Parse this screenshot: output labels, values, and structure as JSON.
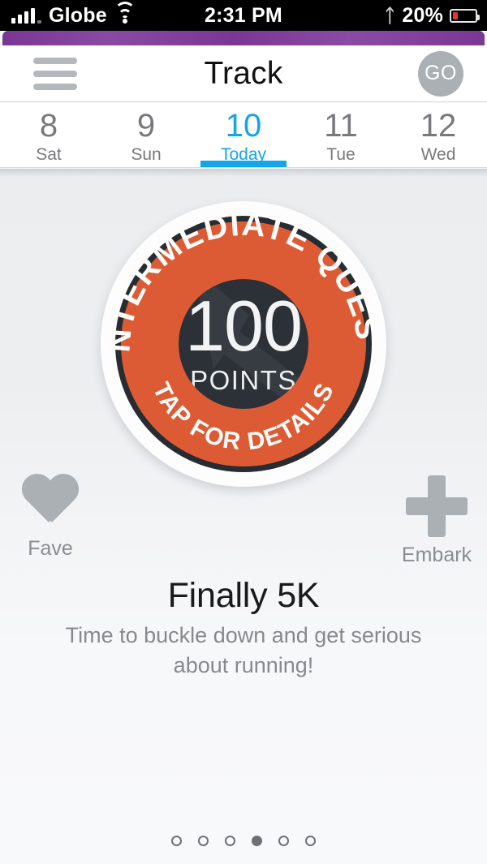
{
  "status_bar": {
    "carrier": "Globe",
    "signal_icon": "signal-bars-icon",
    "wifi_icon": "wifi-icon",
    "time": "2:31 PM",
    "bluetooth_icon": "bluetooth-icon",
    "battery_percent": "20%",
    "battery_icon": "battery-low-icon",
    "battery_level": 20,
    "battery_color": "#e8352c"
  },
  "accent_bar": {
    "color": "#7a3794"
  },
  "header": {
    "menu_icon": "hamburger-menu-icon",
    "title": "Track",
    "go_label": "GO"
  },
  "date_strip": {
    "days": [
      {
        "num": "8",
        "label": "Sat",
        "active": false
      },
      {
        "num": "9",
        "label": "Sun",
        "active": false
      },
      {
        "num": "10",
        "label": "Today",
        "active": true
      },
      {
        "num": "11",
        "label": "Tue",
        "active": false
      },
      {
        "num": "12",
        "label": "Wed",
        "active": false
      }
    ],
    "active_color": "#12a5e8",
    "inactive_color": "#78797c"
  },
  "badge": {
    "arc_top_text": "INTERMEDIATE QUEST",
    "arc_bottom_text": "TAP FOR DETAILS",
    "points_value": "100",
    "points_label": "POINTS",
    "ring_color": "#dd5b34",
    "core_color": "#2b3136",
    "outline_color": "#262c31",
    "watermark_icon": "arrow-dagger-watermark-icon"
  },
  "actions": {
    "left": {
      "icon": "heart-icon",
      "label": "Fave",
      "color": "#abb0b5"
    },
    "right": {
      "icon": "plus-icon",
      "label": "Embark",
      "color": "#abb0b5"
    }
  },
  "quest": {
    "title": "Finally 5K",
    "description": "Time to buckle down and get serious about running!"
  },
  "pager": {
    "total": 6,
    "active_index": 3
  }
}
